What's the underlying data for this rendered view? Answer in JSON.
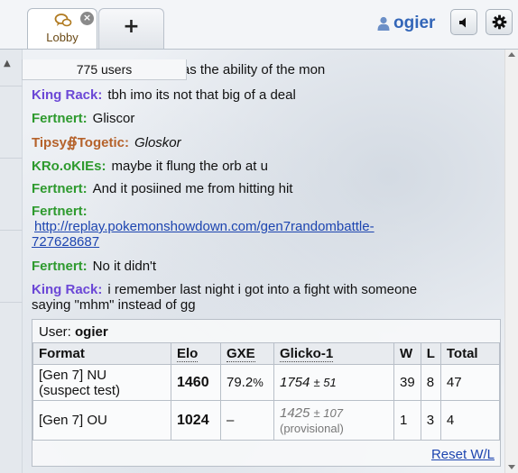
{
  "tabs": [
    {
      "label": "Lobby",
      "icon": "chat-bubbles-icon",
      "active": true,
      "close_label": "×"
    },
    {
      "label": "+",
      "icon": "plus-icon"
    }
  ],
  "header": {
    "username": "ogier",
    "icons": [
      "user-icon",
      "speaker-icon",
      "gear-icon"
    ]
  },
  "userlist": {
    "count_label": "775 users"
  },
  "messages": [
    {
      "nick": "",
      "text": "hat was the ability of the mon"
    },
    {
      "nick": "King Rack:",
      "color": "#6b47d6",
      "text": "tbh imo its not that big of a deal"
    },
    {
      "nick": "Fertnert:",
      "color": "#2e9a2e",
      "text": "Gliscor"
    },
    {
      "nick": "Tipsy∯Togetic:",
      "color": "#b5622b",
      "text": "Gloskor"
    },
    {
      "nick": "KRo.oKIEs:",
      "color": "#2e9a2e",
      "text": "maybe it flung the orb at u"
    },
    {
      "nick": "Fertnert:",
      "color": "#2e9a2e",
      "text": "And it posiined me from hitting hit"
    },
    {
      "nick": "Fertnert:",
      "color": "#2e9a2e",
      "text_line1": "http://replay.pokemonshowdown.com/gen7randombattle-",
      "text_line2": "727628687"
    },
    {
      "nick": "Fertnert:",
      "color": "#2e9a2e",
      "text": "No it didn't"
    },
    {
      "nick": "King Rack:",
      "color": "#6b47d6",
      "text_line1": "i remember last night i got into a fight with someone",
      "text_line2": "saying \"mhm\" instead of gg"
    }
  ],
  "stats": {
    "user_label": "User:",
    "user_name": "ogier",
    "headers": [
      "Format",
      "Elo",
      "GXE",
      "Glicko-1",
      "W",
      "L",
      "Total"
    ],
    "rows": [
      {
        "format_line1": "[Gen 7] NU",
        "format_line2": "(suspect test)",
        "elo": "1460",
        "gxe": "79.2",
        "gxe_unit": "%",
        "glicko": "1754",
        "glicko_dev": "± 51",
        "glicko_note": "",
        "w": "39",
        "l": "8",
        "total": "47"
      },
      {
        "format_line1": "[Gen 7] OU",
        "format_line2": "",
        "elo": "1024",
        "gxe": "–",
        "gxe_unit": "",
        "glicko": "1425",
        "glicko_dev": "± 107",
        "glicko_note": "(provisional)",
        "w": "1",
        "l": "3",
        "total": "4"
      }
    ],
    "reset_label": "Reset W/L"
  }
}
